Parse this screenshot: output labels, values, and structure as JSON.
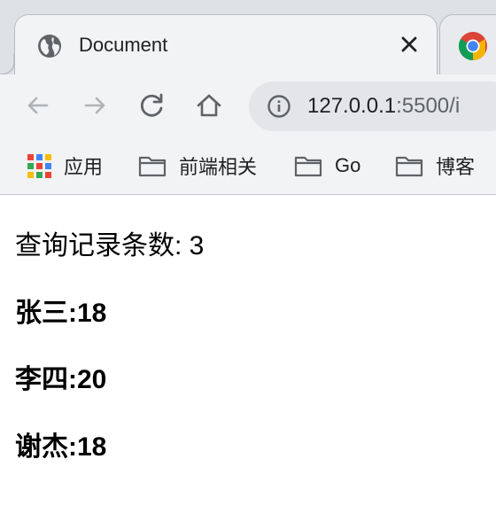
{
  "tabs": [
    {
      "title": "Document",
      "active": true,
      "icon": "globe-icon"
    },
    {
      "title": "",
      "active": false,
      "icon": "chrome-icon"
    }
  ],
  "toolbar": {
    "back_icon": "back-arrow-icon",
    "forward_icon": "forward-arrow-icon",
    "reload_icon": "reload-icon",
    "home_icon": "home-icon",
    "url_host": "127.0.0.1",
    "url_rest": ":5500/i"
  },
  "bookmarks": [
    {
      "label": "应用",
      "icon": "apps-grid-icon"
    },
    {
      "label": "前端相关",
      "icon": "folder-icon"
    },
    {
      "label": "Go",
      "icon": "folder-icon"
    },
    {
      "label": "博客",
      "icon": "folder-icon"
    }
  ],
  "page": {
    "count_label": "查询记录条数: 3",
    "records": [
      {
        "text": "张三:18"
      },
      {
        "text": "李四:20"
      },
      {
        "text": "谢杰:18"
      }
    ]
  },
  "colors": {
    "tabstrip_bg": "#dee1e6",
    "toolbar_bg": "#f1f3f4",
    "omnibox_bg": "#e3e5e8",
    "icon_gray": "#5f6368",
    "disabled_gray": "#b0b3b8"
  }
}
